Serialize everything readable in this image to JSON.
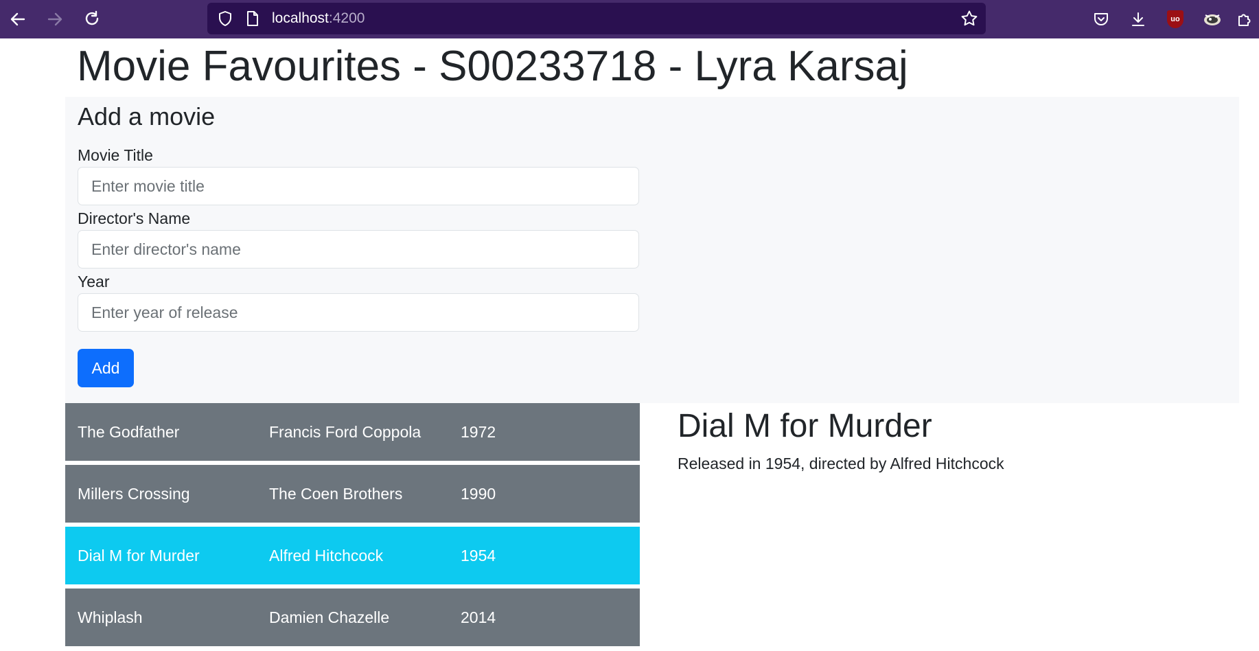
{
  "browser": {
    "url_host": "localhost",
    "url_port": ":4200",
    "icons": [
      "back-arrow-icon",
      "forward-arrow-icon",
      "reload-icon",
      "shield-icon",
      "page-icon",
      "bookmark-star-icon",
      "pocket-icon",
      "download-icon",
      "ublock-icon",
      "extension-icon",
      "puzzle-icon"
    ],
    "ublock_badge": "uo"
  },
  "page": {
    "title": "Movie Favourites - S00233718 - Lyra Karsaj"
  },
  "form": {
    "heading": "Add a movie",
    "fields": [
      {
        "label": "Movie Title",
        "placeholder": "Enter movie title",
        "value": ""
      },
      {
        "label": "Director's Name",
        "placeholder": "Enter director's name",
        "value": ""
      },
      {
        "label": "Year",
        "placeholder": "Enter year of release",
        "value": ""
      }
    ],
    "add_label": "Add"
  },
  "movies": [
    {
      "title": "The Godfather",
      "director": "Francis Ford Coppola",
      "year": "1972",
      "selected": false
    },
    {
      "title": "Millers Crossing",
      "director": "The Coen Brothers",
      "year": "1990",
      "selected": false
    },
    {
      "title": "Dial M for Murder",
      "director": "Alfred Hitchcock",
      "year": "1954",
      "selected": true
    },
    {
      "title": "Whiplash",
      "director": "Damien Chazelle",
      "year": "2014",
      "selected": false
    }
  ],
  "detail": {
    "title": "Dial M for Murder",
    "released_prefix": "Released in ",
    "year": "1954",
    "directed_prefix": ", directed by ",
    "director": "Alfred Hitchcock"
  },
  "colors": {
    "toolbar": "#452a6b",
    "urlbar": "#2a1050",
    "row_default": "#6c757d",
    "row_selected": "#0dcaf0",
    "add_button": "#0d6efd"
  }
}
